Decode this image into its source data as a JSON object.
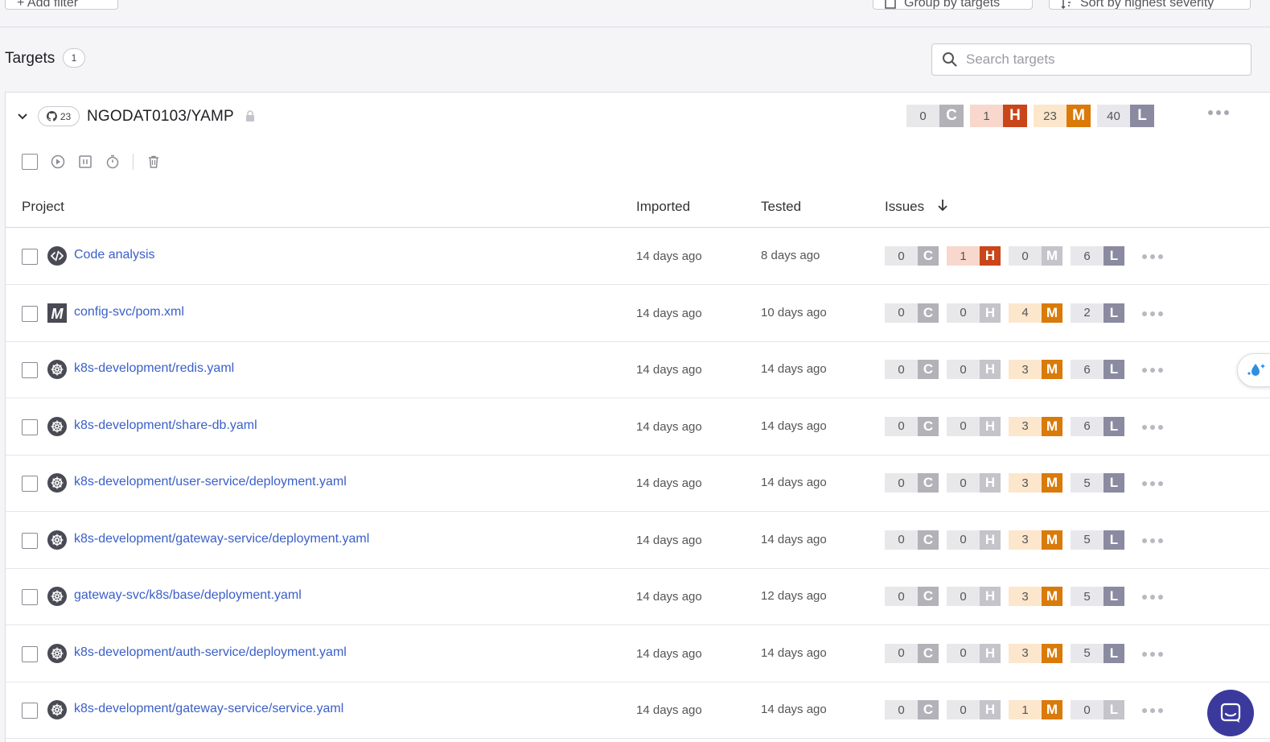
{
  "topbar": {
    "add_filter": "+ Add filter",
    "group_by": "Group by targets",
    "sort_by": "Sort by highest severity"
  },
  "targets": {
    "title": "Targets",
    "count": "1",
    "search_placeholder": "Search targets"
  },
  "repo": {
    "icon": "github-icon",
    "project_count": "23",
    "name": "NGODAT0103/YAMP",
    "severity": {
      "c": "0",
      "h": "1",
      "m": "23",
      "l": "40"
    }
  },
  "columns": {
    "project": "Project",
    "imported": "Imported",
    "tested": "Tested",
    "issues": "Issues"
  },
  "severity_labels": {
    "c": "C",
    "h": "H",
    "m": "M",
    "l": "L"
  },
  "colors": {
    "critical_active": "#b2b2b8",
    "high_active": "#c8461a",
    "medium_active": "#d97a09",
    "low_active": "#8a8aa0",
    "link": "#3a5fc8"
  },
  "projects": [
    {
      "icon": "code-icon",
      "name": "Code analysis",
      "imported": "14 days ago",
      "tested": "8 days ago",
      "c": "0",
      "h": "1",
      "m": "0",
      "l": "6"
    },
    {
      "icon": "maven-icon",
      "name": "config-svc/pom.xml",
      "imported": "14 days ago",
      "tested": "10 days ago",
      "c": "0",
      "h": "0",
      "m": "4",
      "l": "2"
    },
    {
      "icon": "kubernetes-icon",
      "name": "k8s-development/redis.yaml",
      "imported": "14 days ago",
      "tested": "14 days ago",
      "c": "0",
      "h": "0",
      "m": "3",
      "l": "6"
    },
    {
      "icon": "kubernetes-icon",
      "name": "k8s-development/share-db.yaml",
      "imported": "14 days ago",
      "tested": "14 days ago",
      "c": "0",
      "h": "0",
      "m": "3",
      "l": "6"
    },
    {
      "icon": "kubernetes-icon",
      "name": "k8s-development/user-service/deployment.yaml",
      "imported": "14 days ago",
      "tested": "14 days ago",
      "c": "0",
      "h": "0",
      "m": "3",
      "l": "5"
    },
    {
      "icon": "kubernetes-icon",
      "name": "k8s-development/gateway-service/deployment.yaml",
      "imported": "14 days ago",
      "tested": "14 days ago",
      "c": "0",
      "h": "0",
      "m": "3",
      "l": "5"
    },
    {
      "icon": "kubernetes-icon",
      "name": "gateway-svc/k8s/base/deployment.yaml",
      "imported": "14 days ago",
      "tested": "12 days ago",
      "c": "0",
      "h": "0",
      "m": "3",
      "l": "5"
    },
    {
      "icon": "kubernetes-icon",
      "name": "k8s-development/auth-service/deployment.yaml",
      "imported": "14 days ago",
      "tested": "14 days ago",
      "c": "0",
      "h": "0",
      "m": "3",
      "l": "5"
    },
    {
      "icon": "kubernetes-icon",
      "name": "k8s-development/gateway-service/service.yaml",
      "imported": "14 days ago",
      "tested": "14 days ago",
      "c": "0",
      "h": "0",
      "m": "1",
      "l": "0"
    }
  ]
}
